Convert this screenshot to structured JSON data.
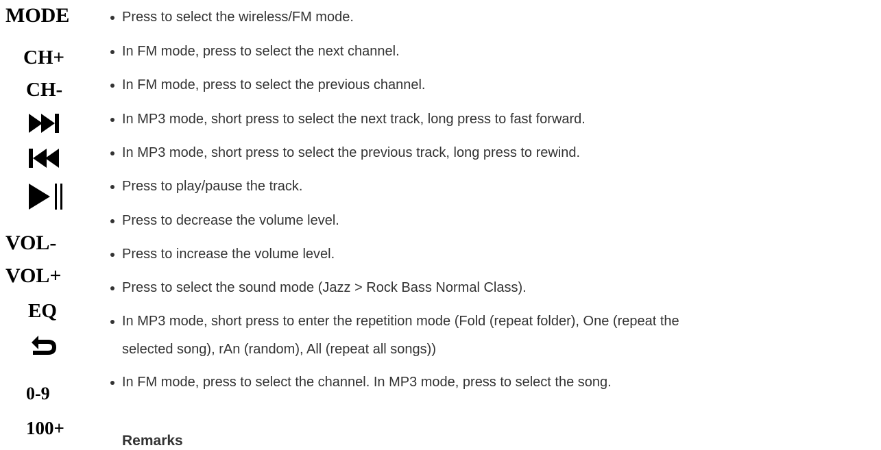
{
  "keys": {
    "mode": "MODE",
    "ch_plus": "CH+",
    "ch_minus": "CH-",
    "next_icon": "next-track-icon",
    "prev_icon": "previous-track-icon",
    "play_pause_icon": "play-pause-icon",
    "vol_minus": "VOL-",
    "vol_plus": "VOL+",
    "eq": "EQ",
    "return_icon": "return-icon",
    "digits": "0-9",
    "hundred_plus": "100+"
  },
  "descriptions": [
    "Press to select the wireless/FM mode.",
    "In FM mode, press to select the next channel.",
    "In FM mode, press to select the previous channel.",
    "In MP3 mode, short press to select the next track, long press to fast forward.",
    "In MP3 mode, short press to select the previous track, long press to rewind.",
    "Press to play/pause the track.",
    "Press to decrease the volume level.",
    "Press to increase the volume level.",
    "Press to select the sound mode (Jazz > Rock Bass Normal Class).",
    "In MP3 mode, short press to enter the repetition mode (Fold (repeat folder), One (repeat the",
    "selected song), rAn (random), All (repeat all songs))",
    "In FM mode, press to select the channel. In MP3 mode, press to select the song."
  ],
  "remarks_heading": "Remarks"
}
